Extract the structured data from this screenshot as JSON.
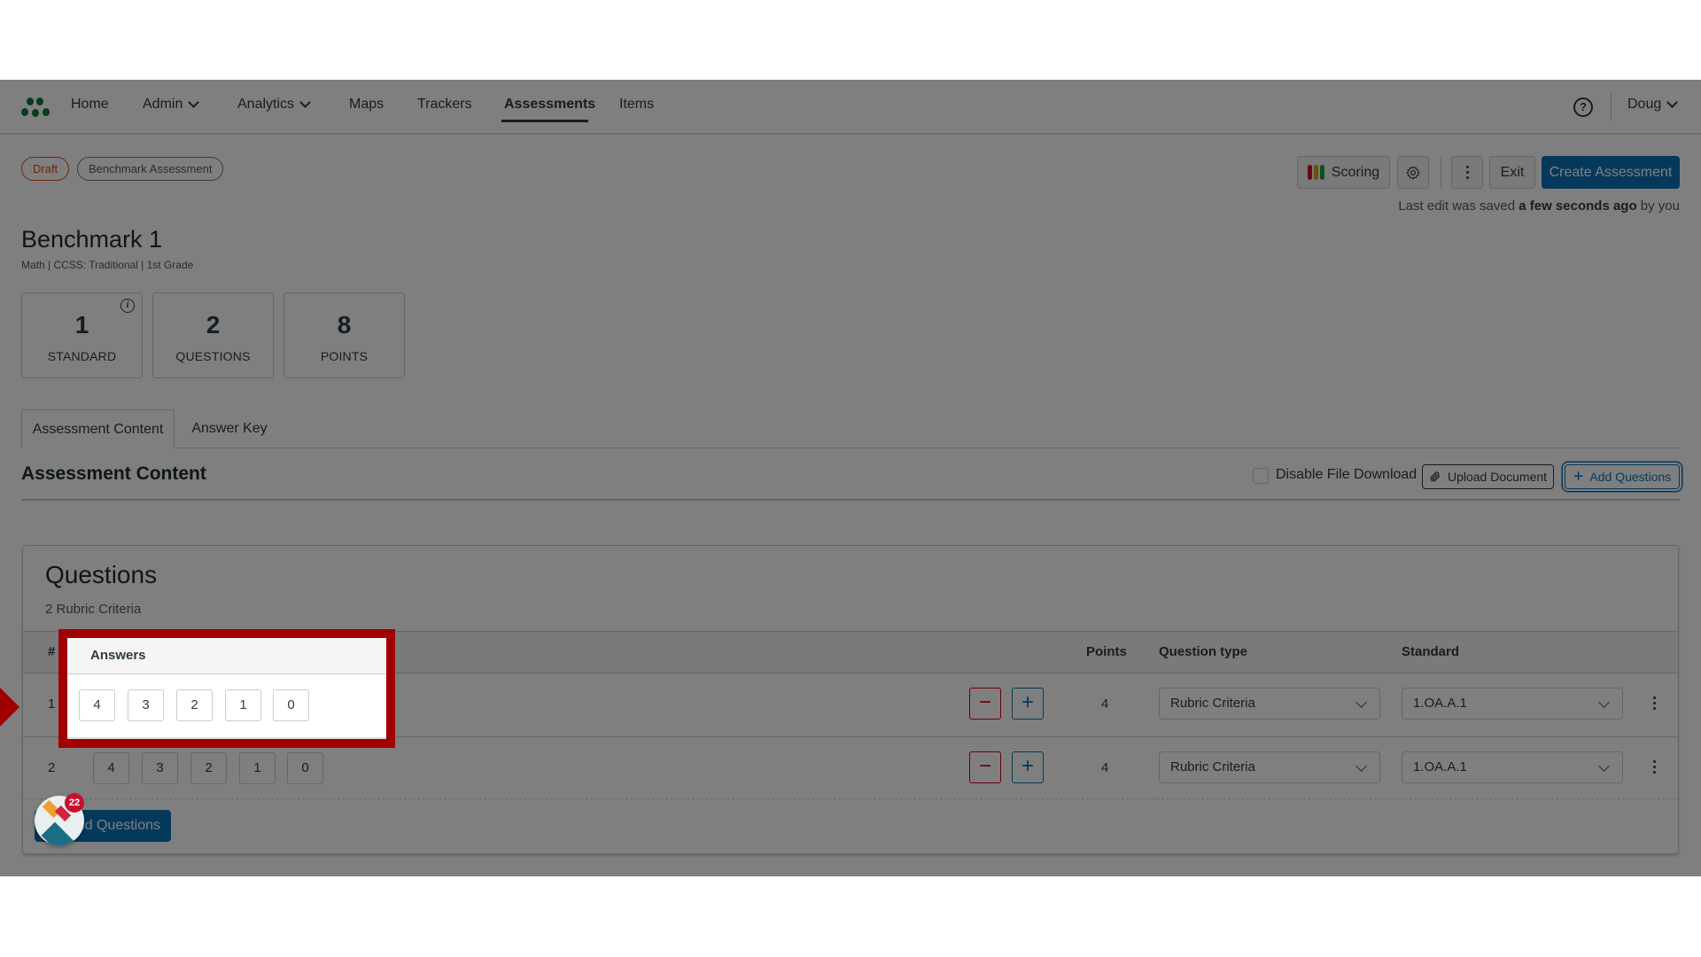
{
  "nav": {
    "items": [
      {
        "label": "Home",
        "has_menu": false
      },
      {
        "label": "Admin",
        "has_menu": true
      },
      {
        "label": "Analytics",
        "has_menu": true
      },
      {
        "label": "Maps",
        "has_menu": false
      },
      {
        "label": "Trackers",
        "has_menu": false
      },
      {
        "label": "Assessments",
        "has_menu": false,
        "active": true
      },
      {
        "label": "Items",
        "has_menu": false
      }
    ],
    "help_icon": "question-circle-icon",
    "user": "Doug"
  },
  "header": {
    "status_badge": "Draft",
    "type_badge": "Benchmark Assessment",
    "buttons": {
      "scoring": "Scoring",
      "settings_icon": "gear-icon",
      "more_icon": "kebab-icon",
      "exit": "Exit",
      "create": "Create Assessment"
    },
    "saved_prefix": "Last edit was saved ",
    "saved_time": "a few seconds ago",
    "saved_suffix": " by you",
    "title": "Benchmark 1",
    "subtitle": "Math  |  CCSS: Traditional  |  1st Grade"
  },
  "stats": [
    {
      "value": "1",
      "label": "STANDARD",
      "info": "i"
    },
    {
      "value": "2",
      "label": "QUESTIONS"
    },
    {
      "value": "8",
      "label": "POINTS"
    }
  ],
  "tabs": [
    {
      "label": "Assessment Content",
      "active": true
    },
    {
      "label": "Answer Key",
      "active": false
    }
  ],
  "content": {
    "section_title": "Assessment Content",
    "disable_download_label": "Disable File Download",
    "disable_download_checked": false,
    "upload_label": "Upload Document",
    "add_questions_label": "Add Questions"
  },
  "questions": {
    "title": "Questions",
    "subtitle": "2 Rubric Criteria",
    "columns": {
      "num": "#",
      "answers": "Answers",
      "points": "Points",
      "type": "Question type",
      "standard": "Standard"
    },
    "rows": [
      {
        "num": "1",
        "answers": [
          "4",
          "3",
          "2",
          "1",
          "0"
        ],
        "points": "4",
        "type": "Rubric Criteria",
        "standard": "1.OA.A.1"
      },
      {
        "num": "2",
        "answers": [
          "4",
          "3",
          "2",
          "1",
          "0"
        ],
        "points": "4",
        "type": "Rubric Criteria",
        "standard": "1.OA.A.1"
      }
    ],
    "minus_symbol": "−",
    "plus_symbol": "+",
    "add_button_label": "Add Questions"
  },
  "widget": {
    "badge_count": "22"
  },
  "colors": {
    "primary": "#0a73b8",
    "draft": "#e0461c",
    "highlight": "#a00000",
    "minus": "#d0021b",
    "logo": "#0b7a3c",
    "scoring_bars": [
      "#c8102e",
      "#d4a017",
      "#1e9e3a"
    ]
  }
}
